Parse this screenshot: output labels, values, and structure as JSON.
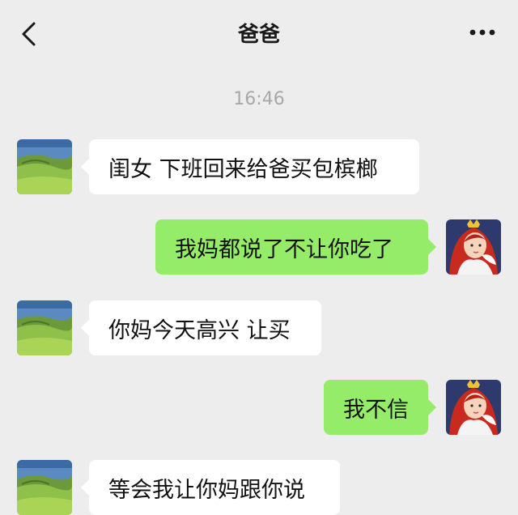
{
  "header": {
    "title": "爸爸",
    "back_icon": "chevron-left-icon",
    "more_icon": "more-dots-icon"
  },
  "timestamp": "16:46",
  "colors": {
    "background": "#ededed",
    "incoming_bubble": "#ffffff",
    "outgoing_bubble": "#95ec69",
    "timestamp_text": "#a8a8a8"
  },
  "messages": [
    {
      "sender": "dad",
      "text": "闺女 下班回来给爸买包槟榔"
    },
    {
      "sender": "me",
      "text": "我妈都说了不让你吃了"
    },
    {
      "sender": "dad",
      "text": "你妈今天高兴 让买"
    },
    {
      "sender": "me",
      "text": "我不信"
    },
    {
      "sender": "dad",
      "text": "等会我让你妈跟你说"
    }
  ],
  "avatars": {
    "dad": "landscape-avatar",
    "me": "cartoon-princess-avatar"
  }
}
